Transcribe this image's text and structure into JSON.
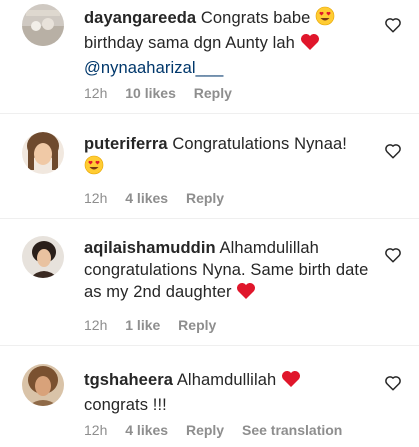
{
  "comments": [
    {
      "username": "dayangareeda",
      "text_parts": [
        "Congrats babe",
        "birthday sama dgn Aunty lah"
      ],
      "mention": "@nynaaharizal___",
      "time": "12h",
      "likes": "10 likes",
      "reply": "Reply"
    },
    {
      "username": "puteriferra",
      "text_parts": [
        "Congratulations Nynaa!"
      ],
      "time": "12h",
      "likes": "4 likes",
      "reply": "Reply"
    },
    {
      "username": "aqilaishamuddin",
      "text_parts": [
        "Alhamdulillah congratulations Nyna. Same birth date as my 2nd daughter"
      ],
      "time": "12h",
      "likes": "1 like",
      "reply": "Reply"
    },
    {
      "username": "tgshaheera",
      "text_parts": [
        "Alhamdullilah",
        "congrats !!!"
      ],
      "time": "12h",
      "likes": "4 likes",
      "reply": "Reply",
      "see_translation": "See translation"
    }
  ],
  "icons": {
    "like": "heart-outline-icon",
    "emoji_heart_eyes": "heart-eyes-emoji",
    "emoji_red_heart": "red-heart-emoji"
  },
  "colors": {
    "mention": "#00376b",
    "meta": "#8e8e8e",
    "heart": "#e0162b",
    "emoji_face": "#ffcc33"
  }
}
